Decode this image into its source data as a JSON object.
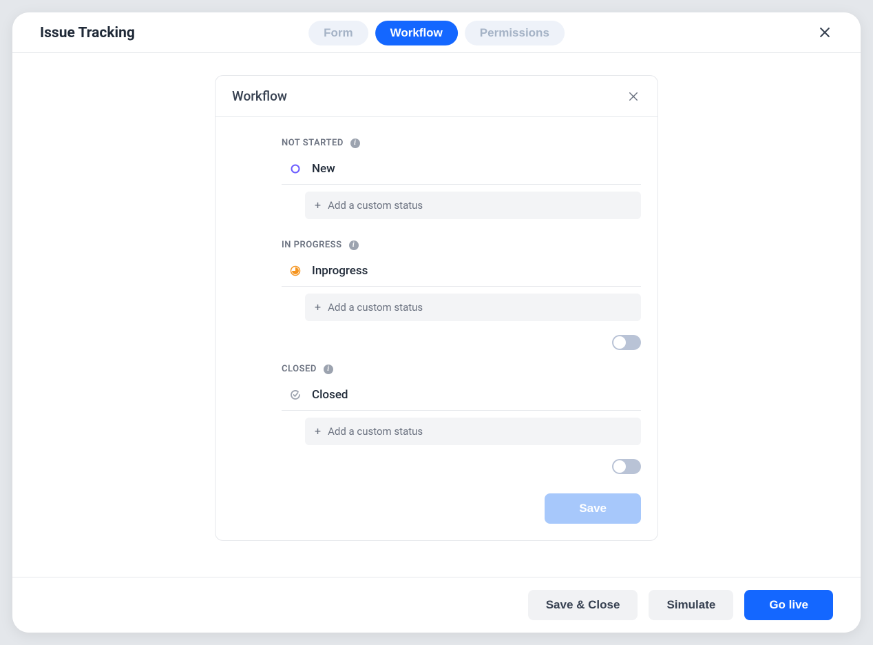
{
  "header": {
    "title": "Issue Tracking",
    "tabs": [
      {
        "label": "Form",
        "active": false
      },
      {
        "label": "Workflow",
        "active": true
      },
      {
        "label": "Permissions",
        "active": false
      }
    ]
  },
  "panel": {
    "title": "Workflow",
    "save_label": "Save",
    "add_custom_label": "Add a custom status",
    "sections": [
      {
        "label": "NOT STARTED",
        "statuses": [
          {
            "name": "New",
            "icon": "circle-open",
            "color": "#6b5cff"
          }
        ],
        "has_toggle": false
      },
      {
        "label": "IN PROGRESS",
        "statuses": [
          {
            "name": "Inprogress",
            "icon": "circle-half",
            "color": "#f5941e"
          }
        ],
        "has_toggle": true
      },
      {
        "label": "CLOSED",
        "statuses": [
          {
            "name": "Closed",
            "icon": "check-circle",
            "color": "#9ca3af"
          }
        ],
        "has_toggle": true
      }
    ]
  },
  "footer": {
    "save_close": "Save & Close",
    "simulate": "Simulate",
    "go_live": "Go live"
  }
}
